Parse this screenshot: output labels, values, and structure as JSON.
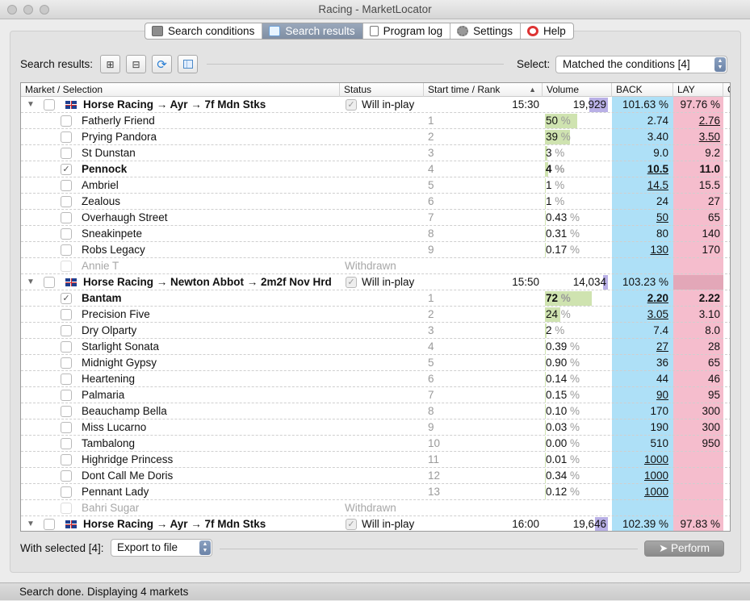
{
  "window": {
    "title": "Racing - MarketLocator"
  },
  "tabs": [
    {
      "label": "Search conditions",
      "icon": "keyboard-icon",
      "active": false
    },
    {
      "label": "Search results",
      "icon": "grid-icon",
      "active": true
    },
    {
      "label": "Program log",
      "icon": "document-icon",
      "active": false
    },
    {
      "label": "Settings",
      "icon": "gear-icon",
      "active": false
    },
    {
      "label": "Help",
      "icon": "lifebuoy-icon",
      "active": false
    }
  ],
  "toolbar": {
    "label": "Search results:",
    "expand_icon": "plus-box-icon",
    "collapse_icon": "minus-box-icon",
    "refresh_icon": "refresh-icon",
    "columns_icon": "columns-icon",
    "select_label": "Select:",
    "select_value": "Matched the conditions [4]"
  },
  "columns": {
    "market": "Market / Selection",
    "status": "Status",
    "start": "Start time / Rank",
    "volume": "Volume",
    "back": "BACK",
    "lay": "LAY",
    "more": "C"
  },
  "markets": [
    {
      "title": "Horse Racing → Ayr → 7f Mdn Stks",
      "status": "Will in-play",
      "time": "15:30",
      "volume": "19,929",
      "back": "101.63 %",
      "lay": "97.76 %",
      "runners": [
        {
          "name": "Fatherly Friend",
          "rank": "1",
          "vol": "50",
          "unit": "%",
          "back": "2.74",
          "lay": "2.76",
          "bu": false,
          "lu": true
        },
        {
          "name": "Prying Pandora",
          "rank": "2",
          "vol": "39",
          "unit": "%",
          "back": "3.40",
          "lay": "3.50",
          "bu": false,
          "lu": true
        },
        {
          "name": "St Dunstan",
          "rank": "3",
          "vol": "3",
          "unit": "%",
          "back": "9.0",
          "lay": "9.2",
          "bu": false,
          "lu": false
        },
        {
          "name": "Pennock",
          "rank": "4",
          "vol": "4",
          "unit": "%",
          "back": "10.5",
          "lay": "11.0",
          "bu": true,
          "lu": false,
          "checked": true,
          "bold": true
        },
        {
          "name": "Ambriel",
          "rank": "5",
          "vol": "1",
          "unit": "%",
          "back": "14.5",
          "lay": "15.5",
          "bu": true,
          "lu": false
        },
        {
          "name": "Zealous",
          "rank": "6",
          "vol": "1",
          "unit": "%",
          "back": "24",
          "lay": "27",
          "bu": false,
          "lu": false
        },
        {
          "name": "Overhaugh Street",
          "rank": "7",
          "vol": "0.43",
          "unit": "%",
          "back": "50",
          "lay": "65",
          "bu": true,
          "lu": false
        },
        {
          "name": "Sneakinpete",
          "rank": "8",
          "vol": "0.31",
          "unit": "%",
          "back": "80",
          "lay": "140",
          "bu": false,
          "lu": false
        },
        {
          "name": "Robs Legacy",
          "rank": "9",
          "vol": "0.17",
          "unit": "%",
          "back": "130",
          "lay": "170",
          "bu": true,
          "lu": false
        },
        {
          "name": "Annie T",
          "withdrawn": "Withdrawn"
        }
      ]
    },
    {
      "title": "Horse Racing → Newton Abbot → 2m2f Nov Hrd",
      "status": "Will in-play",
      "time": "15:50",
      "volume": "14,034",
      "back": "103.23 %",
      "lay": "",
      "runners": [
        {
          "name": "Bantam",
          "rank": "1",
          "vol": "72",
          "unit": "%",
          "back": "2.20",
          "lay": "2.22",
          "bu": true,
          "lu": false,
          "checked": true,
          "bold": true
        },
        {
          "name": "Precision Five",
          "rank": "2",
          "vol": "24",
          "unit": "%",
          "back": "3.05",
          "lay": "3.10",
          "bu": true,
          "lu": false
        },
        {
          "name": "Dry Olparty",
          "rank": "3",
          "vol": "2",
          "unit": "%",
          "back": "7.4",
          "lay": "8.0",
          "bu": false,
          "lu": false
        },
        {
          "name": "Starlight Sonata",
          "rank": "4",
          "vol": "0.39",
          "unit": "%",
          "back": "27",
          "lay": "28",
          "bu": true,
          "lu": false
        },
        {
          "name": "Midnight Gypsy",
          "rank": "5",
          "vol": "0.90",
          "unit": "%",
          "back": "36",
          "lay": "65",
          "bu": false,
          "lu": false
        },
        {
          "name": "Heartening",
          "rank": "6",
          "vol": "0.14",
          "unit": "%",
          "back": "44",
          "lay": "46",
          "bu": false,
          "lu": false
        },
        {
          "name": "Palmaria",
          "rank": "7",
          "vol": "0.15",
          "unit": "%",
          "back": "90",
          "lay": "95",
          "bu": true,
          "lu": false
        },
        {
          "name": "Beauchamp Bella",
          "rank": "8",
          "vol": "0.10",
          "unit": "%",
          "back": "170",
          "lay": "300",
          "bu": false,
          "lu": false
        },
        {
          "name": "Miss Lucarno",
          "rank": "9",
          "vol": "0.03",
          "unit": "%",
          "back": "190",
          "lay": "300",
          "bu": false,
          "lu": false
        },
        {
          "name": "Tambalong",
          "rank": "10",
          "vol": "0.00",
          "unit": "%",
          "back": "510",
          "lay": "950",
          "bu": false,
          "lu": false
        },
        {
          "name": "Highridge Princess",
          "rank": "11",
          "vol": "0.01",
          "unit": "%",
          "back": "1000",
          "lay": "",
          "bu": true,
          "lu": false
        },
        {
          "name": "Dont Call Me Doris",
          "rank": "12",
          "vol": "0.34",
          "unit": "%",
          "back": "1000",
          "lay": "",
          "bu": true,
          "lu": false
        },
        {
          "name": "Pennant Lady",
          "rank": "13",
          "vol": "0.12",
          "unit": "%",
          "back": "1000",
          "lay": "",
          "bu": true,
          "lu": false
        },
        {
          "name": "Bahri Sugar",
          "withdrawn": "Withdrawn"
        }
      ]
    },
    {
      "title": "Horse Racing → Ayr → 7f Mdn Stks",
      "status": "Will in-play",
      "time": "16:00",
      "volume": "19,646",
      "back": "102.39 %",
      "lay": "97.83 %",
      "runners": []
    }
  ],
  "footer": {
    "with_selected": "With selected [4]:",
    "action": "Export to file",
    "perform": "Perform",
    "perform_icon": "paper-plane-icon"
  },
  "statusbar": {
    "text": "Search done. Displaying 4 markets"
  },
  "colors": {
    "back": "#aee0f7",
    "lay": "#f5bdcd",
    "volume_bar": "#cfe3b0",
    "volume_market": "#b9b0e6",
    "active_tab": "#8796ab"
  }
}
